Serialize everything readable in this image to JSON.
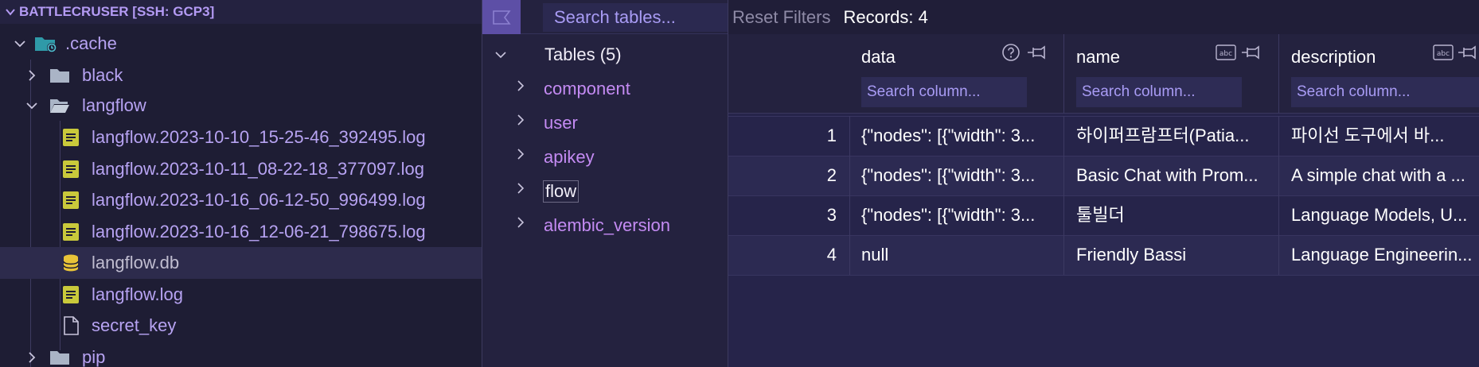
{
  "explorer": {
    "root_label": "BATTLECRUSER [SSH: GCP3]",
    "items": [
      {
        "label": ".cache",
        "icon": "folder-cache-open-icon",
        "expanded": true
      },
      {
        "label": "black",
        "icon": "folder-icon",
        "expanded": false
      },
      {
        "label": "langflow",
        "icon": "folder-open-icon",
        "expanded": true
      },
      {
        "label": "langflow.2023-10-10_15-25-46_392495.log",
        "icon": "log-file-icon"
      },
      {
        "label": "langflow.2023-10-11_08-22-18_377097.log",
        "icon": "log-file-icon"
      },
      {
        "label": "langflow.2023-10-16_06-12-50_996499.log",
        "icon": "log-file-icon"
      },
      {
        "label": "langflow.2023-10-16_12-06-21_798675.log",
        "icon": "log-file-icon"
      },
      {
        "label": "langflow.db",
        "icon": "database-icon",
        "selected": true
      },
      {
        "label": "langflow.log",
        "icon": "log-file-icon"
      },
      {
        "label": "secret_key",
        "icon": "file-icon"
      },
      {
        "label": "pip",
        "icon": "folder-icon",
        "expanded": false
      }
    ]
  },
  "tables_panel": {
    "search_placeholder": "Search tables...",
    "group_label": "Tables (5)",
    "tables": [
      "component",
      "user",
      "apikey",
      "flow",
      "alembic_version"
    ]
  },
  "grid": {
    "reset_label": "Reset Filters",
    "records_label": "Records: 4",
    "columns": [
      {
        "title": "data",
        "filter_placeholder": "Search column..."
      },
      {
        "title": "name",
        "filter_placeholder": "Search column..."
      },
      {
        "title": "description",
        "filter_placeholder": "Search column..."
      }
    ],
    "rows": [
      {
        "num": "1",
        "data": "{\"nodes\": [{\"width\": 3...",
        "name": "하이퍼프람프터(Patia...",
        "description": "파이선 도구에서 바..."
      },
      {
        "num": "2",
        "data": "{\"nodes\": [{\"width\": 3...",
        "name": "Basic Chat with Prom...",
        "description": "A simple chat with a ..."
      },
      {
        "num": "3",
        "data": "{\"nodes\": [{\"width\": 3...",
        "name": "툴빌더",
        "description": "Language Models, U..."
      },
      {
        "num": "4",
        "data": "null",
        "name": "Friendly Bassi",
        "description": "Language Engineerin..."
      }
    ]
  },
  "colors": {
    "accent": "#b49bf4",
    "table_link": "#c48bf3",
    "active_button": "#5d4fa6"
  }
}
